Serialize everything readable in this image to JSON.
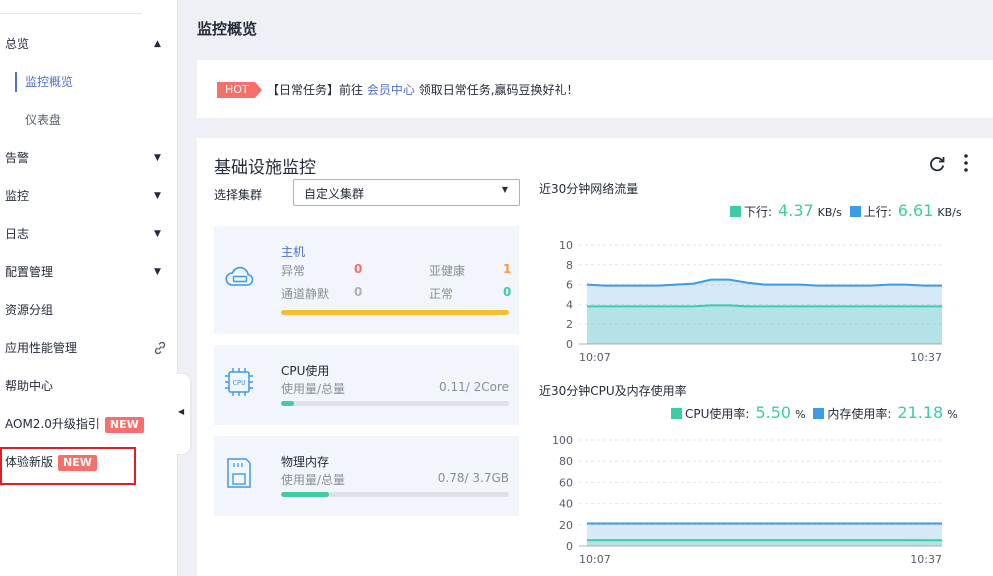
{
  "sidebar": {
    "items": [
      {
        "label": "总览",
        "caret": "▲"
      },
      {
        "label": "监控概览"
      },
      {
        "label": "仪表盘"
      },
      {
        "label": "告警",
        "caret": "▼"
      },
      {
        "label": "监控",
        "caret": "▼"
      },
      {
        "label": "日志",
        "caret": "▼"
      },
      {
        "label": "配置管理",
        "caret": "▼"
      },
      {
        "label": "资源分组"
      },
      {
        "label": "应用性能管理"
      },
      {
        "label": "帮助中心"
      },
      {
        "label": "AOM2.0升级指引",
        "badge": "NEW"
      },
      {
        "label": "体验新版",
        "badge": "NEW"
      }
    ],
    "collapse_glyph": "◀"
  },
  "page": {
    "title": "监控概览"
  },
  "notice": {
    "tag": "HOT",
    "prefix": "【日常任务】前往",
    "link": "会员中心",
    "suffix": "领取日常任务,赢码豆换好礼！"
  },
  "panel": {
    "title": "基础设施监控",
    "cluster_label": "选择集群",
    "cluster_value": "自定义集群",
    "select_caret": "▼",
    "host": {
      "title": "主机",
      "stats": [
        {
          "label": "异常",
          "value": "0",
          "color": "#f66f6a"
        },
        {
          "label": "亚健康",
          "value": "1",
          "color": "#fa9841"
        },
        {
          "label": "通道静默",
          "value": "0",
          "color": "#adb0b8"
        },
        {
          "label": "正常",
          "value": "0",
          "color": "#3dcca6"
        }
      ],
      "bar_color": "#f5bf2a",
      "bar_fraction": 1.0
    },
    "cpu": {
      "title": "CPU使用",
      "usage_label": "使用量/总量",
      "usage_value": "0.11/ 2Core",
      "fraction": 0.055,
      "bar_color": "#3dcca6"
    },
    "mem": {
      "title": "物理内存",
      "usage_label": "使用量/总量",
      "usage_value": "0.78/ 3.7GB",
      "fraction": 0.21,
      "bar_color": "#3dcca6"
    }
  },
  "network_chart": {
    "title": "近30分钟网络流量",
    "legend": [
      {
        "name": "下行:",
        "value": "4.37",
        "unit": "KB/s",
        "color": "#3dcca6"
      },
      {
        "name": "上行:",
        "value": "6.61",
        "unit": "KB/s",
        "color": "#3f9ae5"
      }
    ]
  },
  "cpu_chart": {
    "title": "近30分钟CPU及内存使用率",
    "legend": [
      {
        "name": "CPU使用率:",
        "value": "5.50",
        "unit": "%",
        "color": "#3dcca6"
      },
      {
        "name": "内存使用率:",
        "value": "21.18",
        "unit": "%",
        "color": "#3f9ae5"
      }
    ]
  },
  "chart_data": [
    {
      "type": "area",
      "title": "近30分钟网络流量",
      "x": [
        "10:07",
        "10:37"
      ],
      "ylim": [
        0,
        10
      ],
      "yticks": [
        0,
        2,
        4,
        6,
        8,
        10
      ],
      "series": [
        {
          "name": "上行",
          "color": "#3f9ae5",
          "values": [
            6.0,
            5.9,
            5.9,
            5.9,
            5.9,
            6.0,
            6.1,
            6.5,
            6.5,
            6.2,
            6.0,
            6.0,
            6.0,
            5.9,
            5.9,
            5.9,
            5.9,
            6.0,
            6.0,
            5.9,
            5.9
          ]
        },
        {
          "name": "下行",
          "color": "#3dcca6",
          "values": [
            3.8,
            3.8,
            3.8,
            3.8,
            3.8,
            3.8,
            3.8,
            3.9,
            3.9,
            3.8,
            3.8,
            3.8,
            3.8,
            3.8,
            3.8,
            3.8,
            3.8,
            3.8,
            3.8,
            3.8,
            3.8
          ]
        }
      ]
    },
    {
      "type": "area",
      "title": "近30分钟CPU及内存使用率",
      "x": [
        "10:07",
        "10:37"
      ],
      "ylim": [
        0,
        100
      ],
      "yticks": [
        0,
        20,
        40,
        60,
        80,
        100
      ],
      "series": [
        {
          "name": "内存使用率",
          "color": "#3f9ae5",
          "values": [
            21.2,
            21.2,
            21.2,
            21.2,
            21.2,
            21.2,
            21.2,
            21.2,
            21.2,
            21.2,
            21.2
          ]
        },
        {
          "name": "CPU使用率",
          "color": "#3dcca6",
          "values": [
            5.5,
            5.5,
            5.5,
            5.5,
            5.5,
            5.5,
            5.5,
            5.5,
            5.5,
            5.5,
            5.4
          ]
        }
      ]
    }
  ]
}
